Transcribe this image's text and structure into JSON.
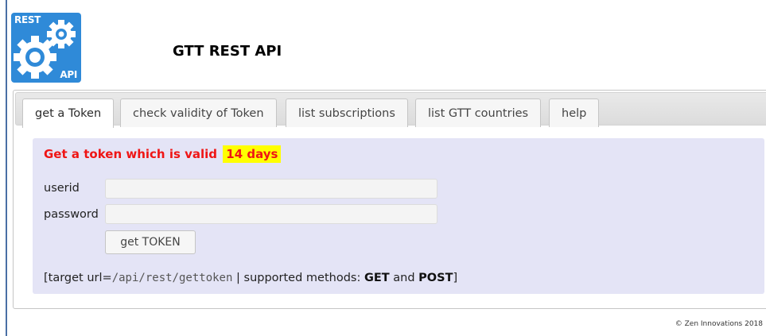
{
  "header": {
    "logo_top": "REST",
    "logo_bottom": "API",
    "title": "GTT REST API"
  },
  "tabs": [
    {
      "label": "get a Token",
      "active": true
    },
    {
      "label": "check validity of Token",
      "active": false
    },
    {
      "label": "list subscriptions",
      "active": false
    },
    {
      "label": "list GTT countries",
      "active": false
    },
    {
      "label": "help",
      "active": false
    }
  ],
  "form": {
    "headline": "Get a token which is valid",
    "validity_badge": "14 days",
    "userid_label": "userid",
    "userid_value": "",
    "password_label": "password",
    "password_value": "",
    "submit_label": "get TOKEN"
  },
  "info": {
    "prefix": "[target url=",
    "url": "/api/rest/gettoken",
    "mid": " | supported methods: ",
    "method_get": "GET",
    "and": " and ",
    "method_post": "POST",
    "suffix": "]"
  },
  "footer": {
    "copyright": "© Zen Innovations 2018"
  },
  "colors": {
    "accent_blue": "#2f8ad8",
    "headline_red": "#ef1515",
    "badge_yellow": "#ffff00",
    "content_bg": "#e4e4f6"
  }
}
